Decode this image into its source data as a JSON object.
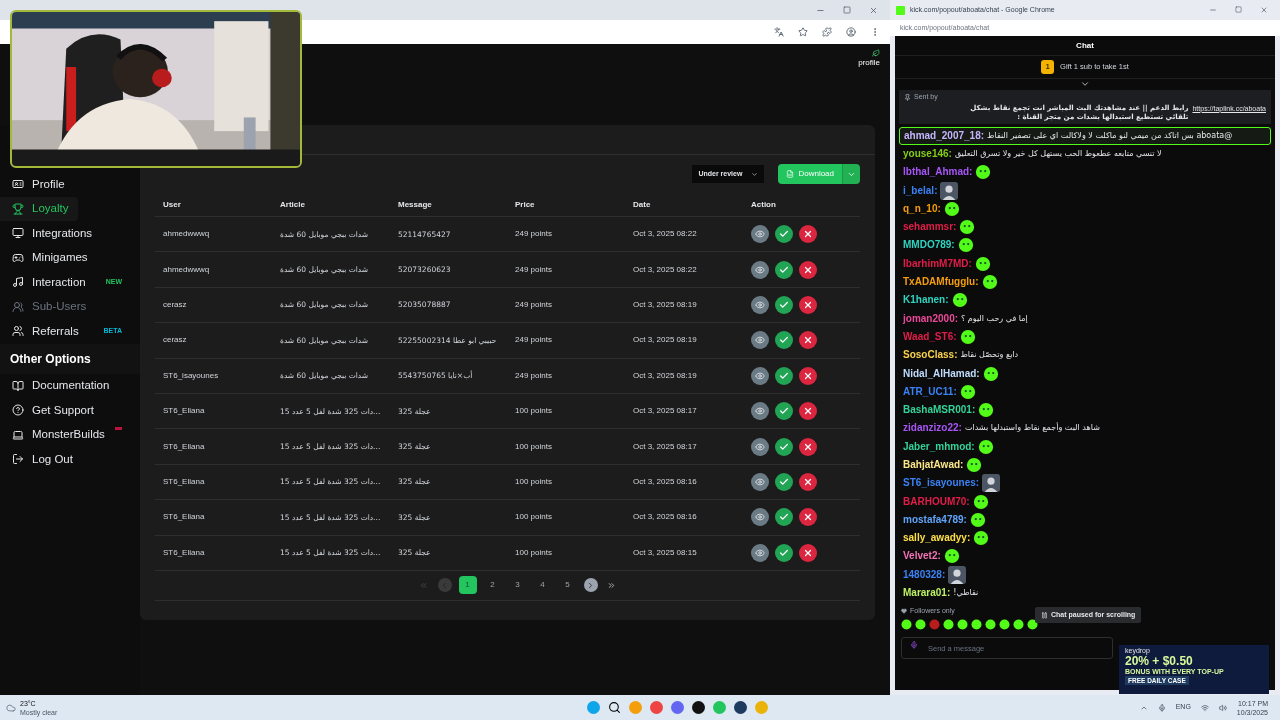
{
  "dashboard": {
    "header_link": "profile",
    "sidebar": [
      {
        "kind": "item",
        "label": "Profile",
        "selected": false,
        "disabled": false
      },
      {
        "kind": "item",
        "label": "Loyalty",
        "selected": true,
        "disabled": false
      },
      {
        "kind": "item",
        "label": "Integrations",
        "selected": false,
        "disabled": false
      },
      {
        "kind": "item",
        "label": "Minigames",
        "selected": false,
        "disabled": false
      },
      {
        "kind": "item",
        "label": "Interaction",
        "selected": false,
        "disabled": false,
        "badge": {
          "text": "NEW",
          "color": "#22c55e"
        }
      },
      {
        "kind": "item",
        "label": "Sub-Users",
        "selected": false,
        "disabled": true
      },
      {
        "kind": "item",
        "label": "Referrals",
        "selected": false,
        "disabled": false,
        "badge": {
          "text": "BETA",
          "color": "#06b6d4"
        }
      },
      {
        "kind": "heading",
        "label": "Other Options"
      },
      {
        "kind": "item",
        "label": "Documentation",
        "selected": false,
        "disabled": false
      },
      {
        "kind": "item",
        "label": "Get Support",
        "selected": false,
        "disabled": false
      },
      {
        "kind": "item",
        "label": "MonsterBuilds",
        "selected": false,
        "disabled": false,
        "badge": {
          "color": "#be123c"
        }
      },
      {
        "kind": "item",
        "label": "Log Out",
        "selected": false,
        "disabled": false
      }
    ],
    "filter": "Under review",
    "download": "Download",
    "columns": [
      "User",
      "Article",
      "Message",
      "Price",
      "Date",
      "Action"
    ],
    "rows": [
      {
        "user": "ahmedwwwq",
        "article": "شدات ببجي موبايل 60 شدة",
        "message": "52114765427",
        "price": "249 points",
        "date": "Oct 3, 2025 08:22"
      },
      {
        "user": "ahmedwwwq",
        "article": "شدات ببجي موبايل 60 شدة",
        "message": "52073260623",
        "price": "249 points",
        "date": "Oct 3, 2025 08:22"
      },
      {
        "user": "cerasz",
        "article": "شدات ببجي موبايل 60 شدة",
        "message": "52035078887",
        "price": "249 points",
        "date": "Oct 3, 2025 08:19"
      },
      {
        "user": "cerasz",
        "article": "شدات ببجي موبايل 60 شدة",
        "message": "52255002314 حبيبي ابو عطا",
        "price": "249 points",
        "date": "Oct 3, 2025 08:19"
      },
      {
        "user": "ST6_isayounes",
        "article": "شدات ببجي موبايل 60 شدة",
        "message": "5543750765 أب×نايا",
        "price": "249 points",
        "date": "Oct 3, 2025 08:19"
      },
      {
        "user": "ST6_Eliana",
        "article": "...دات 325 شدة لفل 5 عدد 15",
        "message": "325 عجلة",
        "price": "100 points",
        "date": "Oct 3, 2025 08:17"
      },
      {
        "user": "ST6_Eliana",
        "article": "...دات 325 شدة لفل 5 عدد 15",
        "message": "325 عجلة",
        "price": "100 points",
        "date": "Oct 3, 2025 08:17"
      },
      {
        "user": "ST6_Eliana",
        "article": "...دات 325 شدة لفل 5 عدد 15",
        "message": "325 عجلة",
        "price": "100 points",
        "date": "Oct 3, 2025 08:16"
      },
      {
        "user": "ST6_Eliana",
        "article": "...دات 325 شدة لفل 5 عدد 15",
        "message": "325 عجلة",
        "price": "100 points",
        "date": "Oct 3, 2025 08:16"
      },
      {
        "user": "ST6_Eliana",
        "article": "...دات 325 شدة لفل 5 عدد 15",
        "message": "325 عجلة",
        "price": "100 points",
        "date": "Oct 3, 2025 08:15"
      }
    ],
    "pagination": {
      "first_disabled": true,
      "prev_disabled": true,
      "pages": [
        {
          "label": "1",
          "selected": true
        },
        {
          "label": "2",
          "selected": false
        },
        {
          "label": "3",
          "selected": false
        },
        {
          "label": "4",
          "selected": false
        },
        {
          "label": "5",
          "selected": false
        }
      ]
    }
  },
  "chat_window": {
    "title": "kick.com/popout/aboata/chat - Google Chrome",
    "url": "kick.com/popout/aboata/chat",
    "header": "Chat",
    "gift": {
      "rank": "1",
      "text": "Gift 1 sub to take 1st"
    },
    "pinned": {
      "sent_by": "Sent by",
      "text": "رابط الدعم || عند مشاهدتك البث المباشر انت تجمع نقاط بشكل تلقائي تستطيع استبدالها بشدات من متجر القناة : ",
      "link": "https://taplink.cc/aboata"
    },
    "messages": [
      {
        "user": "ahmad_2007_18:",
        "color": "#c4b5fd",
        "highlighted": true,
        "kind": "text",
        "text": "@aboata بس اتاكد من ميمي لنو ماكلت لا ولاكالت اي على تصفير النقاط"
      },
      {
        "user": "youse146:",
        "color": "#84cc16",
        "highlighted": false,
        "kind": "text",
        "text": "لا تنسي متابعه عطعوط الحب يستهل كل خير ولا تسرق التعليق"
      },
      {
        "user": "lbthal_Ahmad:",
        "color": "#a855f7",
        "highlighted": false,
        "kind": "emote"
      },
      {
        "user": "i_belal:",
        "color": "#3b82f6",
        "highlighted": false
      },
      {
        "user": "q_n_10:",
        "color": "#f59e0b",
        "highlighted": false,
        "kind": "emote"
      },
      {
        "user": "sehammsr:",
        "color": "#e11d48",
        "highlighted": false,
        "kind": "emote"
      },
      {
        "user": "MMDO789:",
        "color": "#2dd4bf",
        "highlighted": false,
        "kind": "emote"
      },
      {
        "user": "IbarhimM7MD:",
        "color": "#e11d48",
        "highlighted": false,
        "kind": "emote"
      },
      {
        "user": "TxADAMfugglu:",
        "color": "#f59e0b",
        "highlighted": false,
        "kind": "emote"
      },
      {
        "user": "K1hanen:",
        "color": "#2dd4bf",
        "highlighted": false,
        "kind": "emote"
      },
      {
        "user": "joman2000:",
        "color": "#ec4899",
        "highlighted": false,
        "kind": "text",
        "text": "إما في رحب اليوم ؟"
      },
      {
        "user": "Waad_ST6:",
        "color": "#e11d48",
        "highlighted": false,
        "kind": "emote"
      },
      {
        "user": "SosoClass:",
        "color": "#fcd34d",
        "highlighted": false,
        "kind": "text",
        "text": "دابع وتحصّل نقاط"
      },
      {
        "user": "Nidal_AlHamad:",
        "color": "#bfdbfe",
        "highlighted": false,
        "kind": "emote"
      },
      {
        "user": "ATR_UC11:",
        "color": "#3b82f6",
        "highlighted": false,
        "kind": "emote"
      },
      {
        "user": "BashaMSR001:",
        "color": "#34d399",
        "highlighted": false,
        "kind": "emote"
      },
      {
        "user": "zidanzizo22:",
        "color": "#a855f7",
        "highlighted": false,
        "kind": "text",
        "text": "شاهد البث وأجمع نقاط واستبدلها بشدات"
      },
      {
        "user": "Jaber_mhmod:",
        "color": "#34d399",
        "highlighted": false,
        "kind": "emote"
      },
      {
        "user": "BahjatAwad:",
        "color": "#fde68a",
        "highlighted": false,
        "kind": "emote"
      },
      {
        "user": "ST6_isayounes:",
        "color": "#3b82f6",
        "highlighted": false
      },
      {
        "user": "BARHOUM70:",
        "color": "#e11d48",
        "highlighted": false,
        "kind": "emote"
      },
      {
        "user": "mostafa4789:",
        "color": "#60a5fa",
        "highlighted": false,
        "kind": "emote"
      },
      {
        "user": "sally_awadyy:",
        "color": "#fde047",
        "highlighted": false,
        "kind": "emote"
      },
      {
        "user": "Velvet2:",
        "color": "#f472b6",
        "highlighted": false,
        "kind": "emote"
      },
      {
        "user": "1480328:",
        "color": "#3b82f6",
        "highlighted": false
      },
      {
        "user": "Marara01:",
        "color": "#bef264",
        "highlighted": false,
        "kind": "text",
        "text": "نقاطي!"
      }
    ],
    "paused": "Chat paused for scrolling",
    "followers_only": "Followers only",
    "input_placeholder": "Send a message"
  },
  "ad": {
    "brand": "keydrop",
    "headline": "20% + $0.50",
    "subline": "BONUS WITH EVERY TOP-UP",
    "cta": "FREE DAILY CASE"
  },
  "taskbar": {
    "temperature": "23°C",
    "weather": "Mostly clear",
    "language": "ENG",
    "time": "10:17 PM",
    "date": "10/3/2025"
  }
}
